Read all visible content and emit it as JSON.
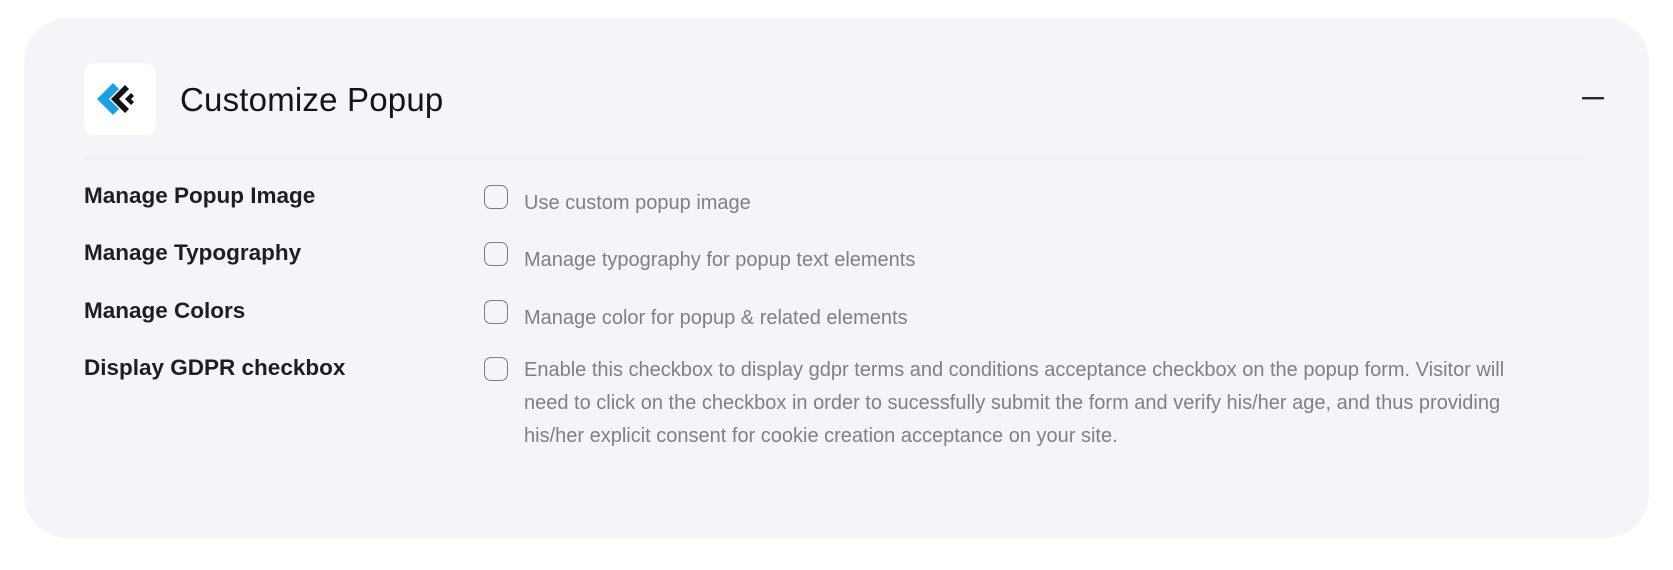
{
  "header": {
    "title": "Customize Popup",
    "logo_icon": "brand-logo-icon",
    "collapse_icon": "minus-icon"
  },
  "colors": {
    "panel_bg": "#f4f5f9",
    "logo_blue": "#1ba1e2",
    "logo_dark": "#111318"
  },
  "settings": [
    {
      "label": "Manage Popup Image",
      "description": "Use custom popup image",
      "checked": false
    },
    {
      "label": "Manage Typography",
      "description": "Manage typography for popup text elements",
      "checked": false
    },
    {
      "label": "Manage Colors",
      "description": "Manage color for popup & related elements",
      "checked": false
    },
    {
      "label": "Display GDPR checkbox",
      "description": "Enable this checkbox to display gdpr terms and conditions acceptance checkbox on the popup form. Visitor will need to click on the checkbox in order to sucessfully submit the form and verify his/her age, and thus providing his/her explicit consent for cookie creation acceptance on your site.",
      "checked": false
    }
  ]
}
